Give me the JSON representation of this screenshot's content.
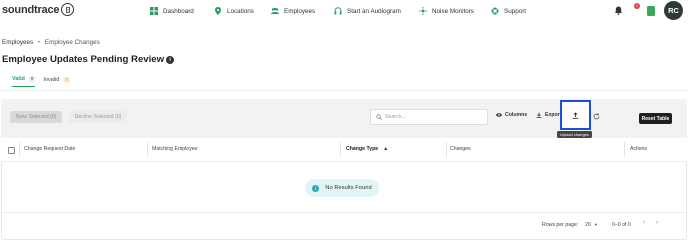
{
  "app": {
    "logo_text": "soundtrace"
  },
  "nav": {
    "items": [
      {
        "label": "Dashboard",
        "icon": "dashboard-icon"
      },
      {
        "label": "Locations",
        "icon": "location-pin-icon"
      },
      {
        "label": "Employees",
        "icon": "people-icon"
      },
      {
        "label": "Start an Audiogram",
        "icon": "headphones-icon"
      },
      {
        "label": "Noise Monitors",
        "icon": "noise-monitor-icon"
      },
      {
        "label": "Support",
        "icon": "lifebuoy-icon"
      }
    ],
    "notification_count": "1",
    "avatar_initials": "RC"
  },
  "breadcrumb": {
    "parent": "Employees",
    "separator": "•",
    "current": "Employee Changes"
  },
  "page": {
    "title": "Employee Updates Pending Review"
  },
  "tabs": [
    {
      "label": "Valid",
      "count": "0"
    },
    {
      "label": "Invalid",
      "count": "0"
    }
  ],
  "toolbar": {
    "sync_label": "Sync Selected (0)",
    "decline_label": "Decline Selected (0)",
    "search_placeholder": "Search…",
    "columns_label": "Columns",
    "export_label": "Export",
    "upload_tooltip": "Upload changes",
    "reset_label": "Reset Table"
  },
  "table": {
    "columns": [
      "Change Request Date",
      "Matching Employee",
      "Change Type",
      "Changes",
      "Actions"
    ],
    "sort_indicator": "▲",
    "empty_message": "No Results Found"
  },
  "pagination": {
    "rows_label": "Rows per page:",
    "rows_value": "20",
    "range": "0–0 of 0",
    "prev": "‹",
    "next": "›"
  },
  "colors": {
    "accent": "#2b9c5f",
    "highlight": "#1d4fd6",
    "dark_button": "#1f1f1f"
  }
}
